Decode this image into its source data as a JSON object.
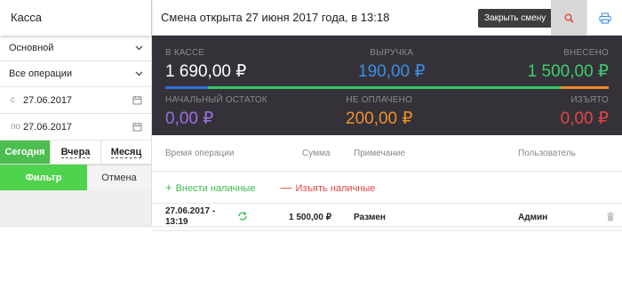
{
  "sidebar": {
    "title": "Касса",
    "select_main": "Основной",
    "select_ops": "Все операции",
    "date_from_prefix": "с",
    "date_from": "27.06.2017",
    "date_to_prefix": "по",
    "date_to": "27.06.2017",
    "period": [
      "Сегодня",
      "Вчера",
      "Месяц"
    ],
    "filter_label": "Фильтр",
    "cancel_label": "Отмена"
  },
  "header": {
    "title": "Смена открыта 27 июня 2017 года, в 13:18",
    "tooltip": "Закрыть смену",
    "search_icon": "search-icon",
    "print_icon": "print-icon"
  },
  "stats": {
    "in_cash": {
      "label": "В КАССЕ",
      "value": "1 690,00 ₽",
      "color": "#ffffff"
    },
    "revenue": {
      "label": "ВЫРУЧКА",
      "value": "190,00 ₽",
      "color": "#3d8ee6"
    },
    "deposited": {
      "label": "ВНЕСЕНО",
      "value": "1 500,00 ₽",
      "color": "#3ccf6e"
    },
    "opening": {
      "label": "НАЧАЛЬНЫЙ ОСТАТОК",
      "value": "0,00 ₽",
      "color": "#9a6fe0"
    },
    "unpaid": {
      "label": "НЕ ОПЛАЧЕНО",
      "value": "200,00 ₽",
      "color": "#f0902e"
    },
    "withdrawn": {
      "label": "ИЗЪЯТО",
      "value": "0,00 ₽",
      "color": "#e04646"
    }
  },
  "table": {
    "columns": [
      "Время операции",
      "Сумма",
      "Примечание",
      "Пользователь"
    ],
    "deposit_label": "Внести наличные",
    "withdraw_label": "Изъять наличные",
    "rows": [
      {
        "time": "27.06.2017 - 13:19",
        "time_line1": "27.06.2017 -",
        "time_line2": "13:19",
        "amount": "1 500,00 ₽",
        "note": "Размен",
        "user": "Админ"
      }
    ]
  }
}
